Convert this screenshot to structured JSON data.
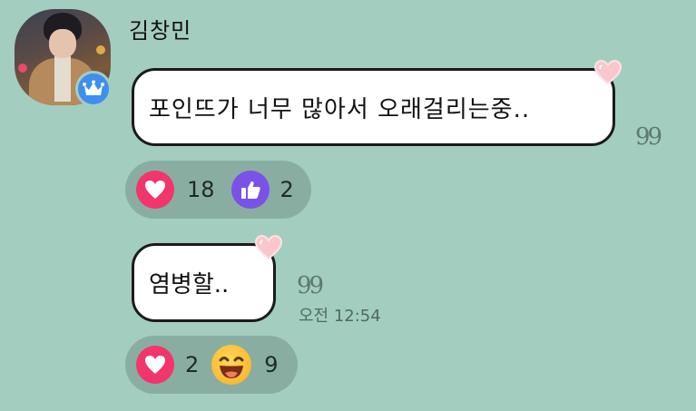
{
  "sender": {
    "name": "김창민",
    "avatar_icon": "user-avatar-photo",
    "badge_icon": "crown-icon",
    "badge_color": "#3d8ff0"
  },
  "messages": [
    {
      "text": "포인뜨가 너무 많아서 오래걸리는중..",
      "quote_mark": "99",
      "reactions": [
        {
          "icon": "heart-icon",
          "color": "#f2356b",
          "count": "18"
        },
        {
          "icon": "thumbs-up-icon",
          "color": "#7b52e8",
          "count": "2"
        }
      ]
    },
    {
      "text": "염병할..",
      "quote_mark": "99",
      "time": "오전 12:54",
      "reactions": [
        {
          "icon": "heart-icon",
          "color": "#f2356b",
          "count": "2"
        },
        {
          "icon": "laughing-emoji-icon",
          "color": "#f9b52d",
          "count": "9"
        }
      ]
    }
  ],
  "colors": {
    "background": "#a3cdbf",
    "bubble": "#ffffff",
    "reaction_bar": "#8aada2"
  }
}
